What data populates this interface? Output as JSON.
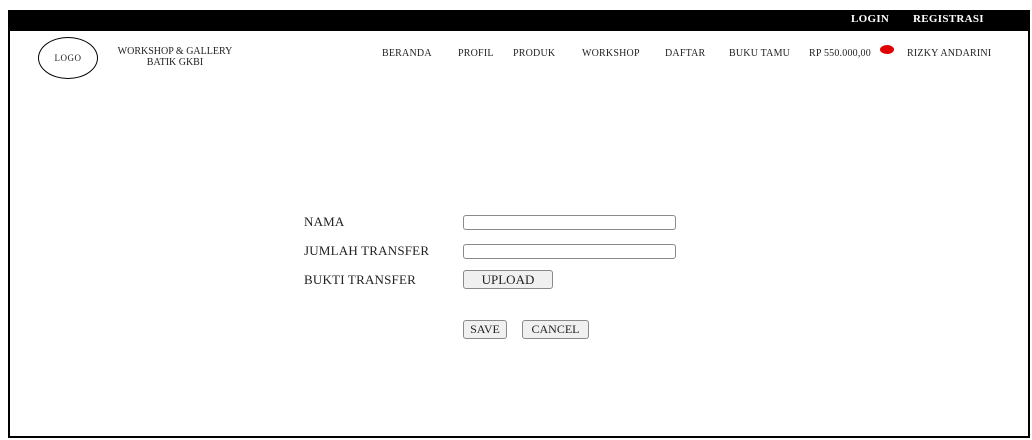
{
  "topbar": {
    "login": "LOGIN",
    "register": "REGISTRASI"
  },
  "header": {
    "logo": "LOGO",
    "brand_line1": "WORKSHOP & GALLERY",
    "brand_line2": "BATIK GKBI",
    "nav": [
      "BERANDA",
      "PROFIL",
      "PRODUK",
      "WORKSHOP",
      "DAFTAR",
      "BUKU TAMU"
    ],
    "cart_total": "RP 550.000,00",
    "user_name": "RIZKY ANDARINI"
  },
  "form": {
    "name_label": "NAMA",
    "name_value": "",
    "amount_label": "JUMLAH TRANSFER",
    "amount_value": "",
    "proof_label": "BUKTI TRANSFER",
    "upload_button": "UPLOAD",
    "save_button": "SAVE",
    "cancel_button": "CANCEL"
  },
  "colors": {
    "topbar": "#000000",
    "badge": "#e00000"
  }
}
